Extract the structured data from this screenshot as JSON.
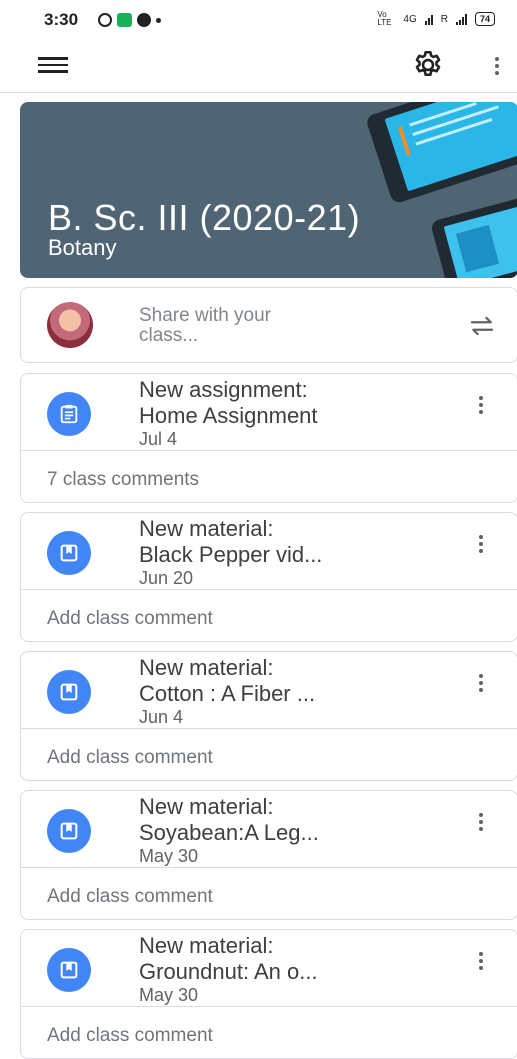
{
  "status_bar": {
    "time": "3:30",
    "battery": "74",
    "network_label": "4G",
    "volte": "Vo LTE",
    "roaming": "R"
  },
  "appbar": {
    "menu_icon": "menu-icon",
    "settings_icon": "gear-icon",
    "more_icon": "more-vert-icon"
  },
  "banner": {
    "title": "B. Sc. III (2020-21)",
    "subtitle": "Botany",
    "color": "#4f6573"
  },
  "share": {
    "placeholder_line1": "Share with your",
    "placeholder_line2": "class...",
    "repost_icon": "repost-icon"
  },
  "posts": [
    {
      "title_line1": "New assignment:",
      "title_line2": "Home Assignment",
      "date": "Jul 4",
      "comment": "7 class comments",
      "icon": "assignment-icon"
    },
    {
      "title_line1": "New material:",
      "title_line2": "Black Pepper vid...",
      "date": "Jun 20",
      "comment": "Add class comment",
      "icon": "material-icon"
    },
    {
      "title_line1": "New material:",
      "title_line2": "Cotton : A Fiber ...",
      "date": "Jun 4",
      "comment": "Add class comment",
      "icon": "material-icon"
    },
    {
      "title_line1": "New material:",
      "title_line2": "Soyabean:A Leg...",
      "date": "May 30",
      "comment": "Add class comment",
      "icon": "material-icon"
    },
    {
      "title_line1": "New material:",
      "title_line2": "Groundnut: An o...",
      "date": "May 30",
      "comment": "Add class comment",
      "icon": "material-icon"
    }
  ],
  "colors": {
    "accent": "#4285f4",
    "divider": "#dadce0"
  }
}
